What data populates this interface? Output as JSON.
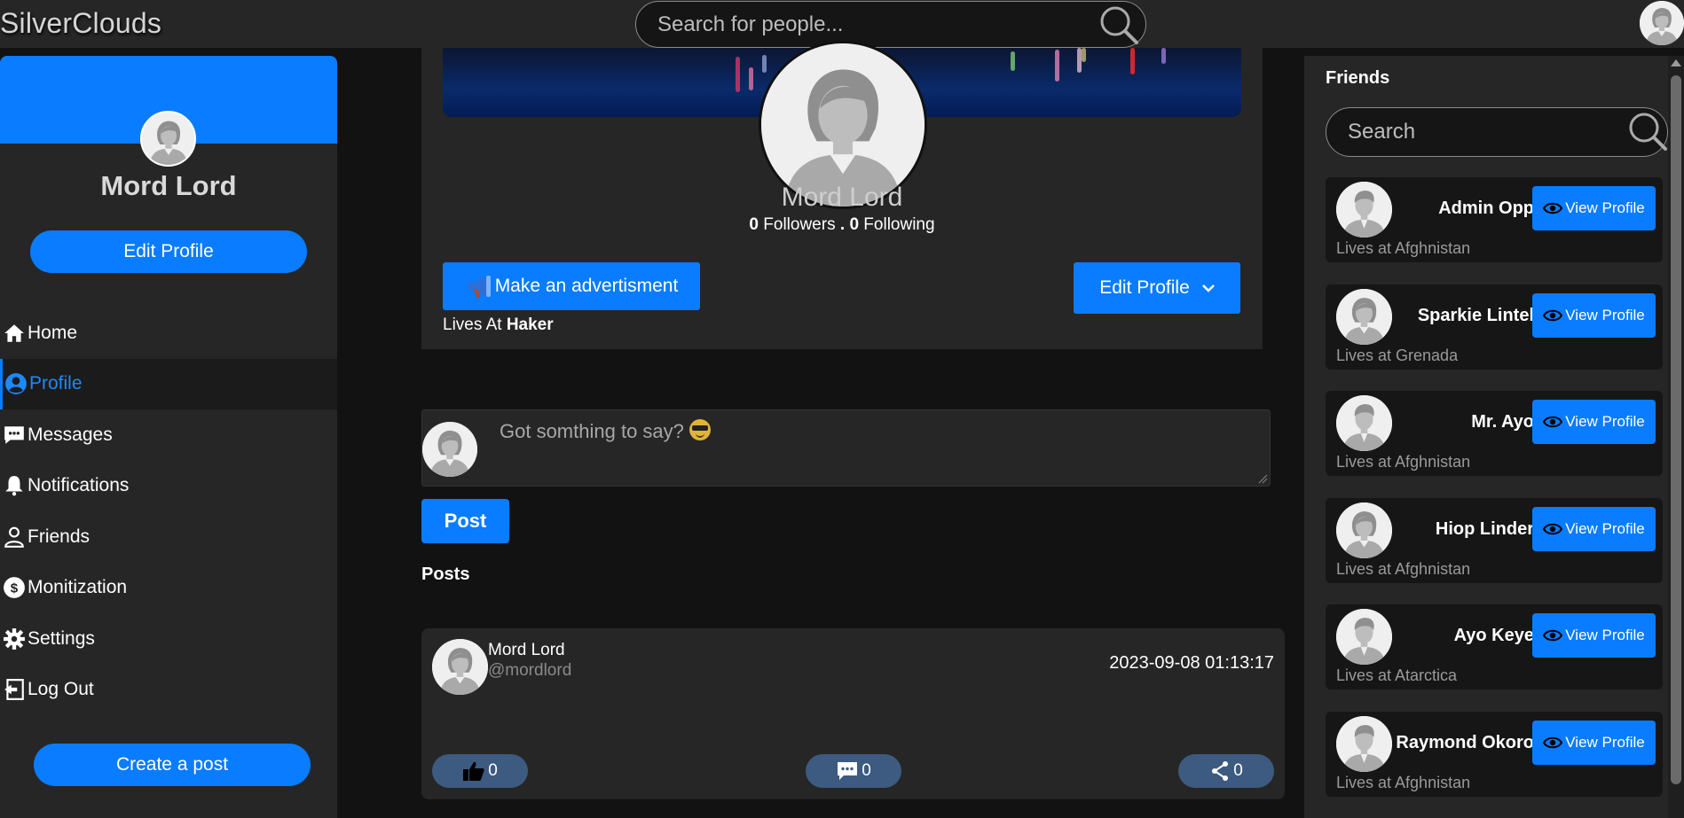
{
  "topbar": {
    "brand": "SilverClouds",
    "search_placeholder": "Search for people..."
  },
  "sidebar": {
    "user_name": "Mord Lord",
    "edit_profile_label": "Edit Profile",
    "nav": [
      {
        "label": "Home",
        "icon": "home-icon"
      },
      {
        "label": "Profile",
        "icon": "user-circle-icon",
        "active": true
      },
      {
        "label": "Messages",
        "icon": "message-icon"
      },
      {
        "label": "Notifications",
        "icon": "bell-icon"
      },
      {
        "label": "Friends",
        "icon": "friends-icon"
      },
      {
        "label": "Monitization",
        "icon": "dollar-icon"
      },
      {
        "label": "Settings",
        "icon": "gear-icon"
      },
      {
        "label": "Log Out",
        "icon": "logout-icon"
      }
    ],
    "create_post_label": "Create a post"
  },
  "profile": {
    "name": "Mord Lord",
    "followers_count": "0",
    "followers_label": "Followers",
    "separator": ".",
    "following_count": "0",
    "following_label": "Following",
    "ad_button_label": "Make an advertisment",
    "lives_prefix": "Lives At",
    "lives_place": "Haker",
    "edit_profile_label": "Edit Profile"
  },
  "composer": {
    "placeholder": "Got somthing to say?",
    "post_button_label": "Post"
  },
  "posts": {
    "heading": "Posts",
    "items": [
      {
        "author": "Mord Lord",
        "handle": "@mordlord",
        "timestamp": "2023-09-08 01:13:17",
        "likes": "0",
        "comments": "0",
        "shares": "0"
      }
    ]
  },
  "friends": {
    "title": "Friends",
    "search_placeholder": "Search",
    "view_label": "View Profile",
    "list": [
      {
        "name": "Admin Opp",
        "lives": "Lives at Afghnistan",
        "avatar": "male"
      },
      {
        "name": "Sparkie Lintel",
        "lives": "Lives at Grenada",
        "avatar": "female"
      },
      {
        "name": "Mr. Ayo",
        "lives": "Lives at Afghnistan",
        "avatar": "male"
      },
      {
        "name": "Hiop Linder",
        "lives": "Lives at Afghnistan",
        "avatar": "female"
      },
      {
        "name": "Ayo Keye",
        "lives": "Lives at Atarctica",
        "avatar": "male"
      },
      {
        "name": "Raymond Okoro",
        "lives": "Lives at Afghnistan",
        "avatar": "male"
      }
    ]
  },
  "colors": {
    "accent": "#0a7cff",
    "panel": "#262626",
    "background": "#121212",
    "reaction": "#3d5a80"
  }
}
